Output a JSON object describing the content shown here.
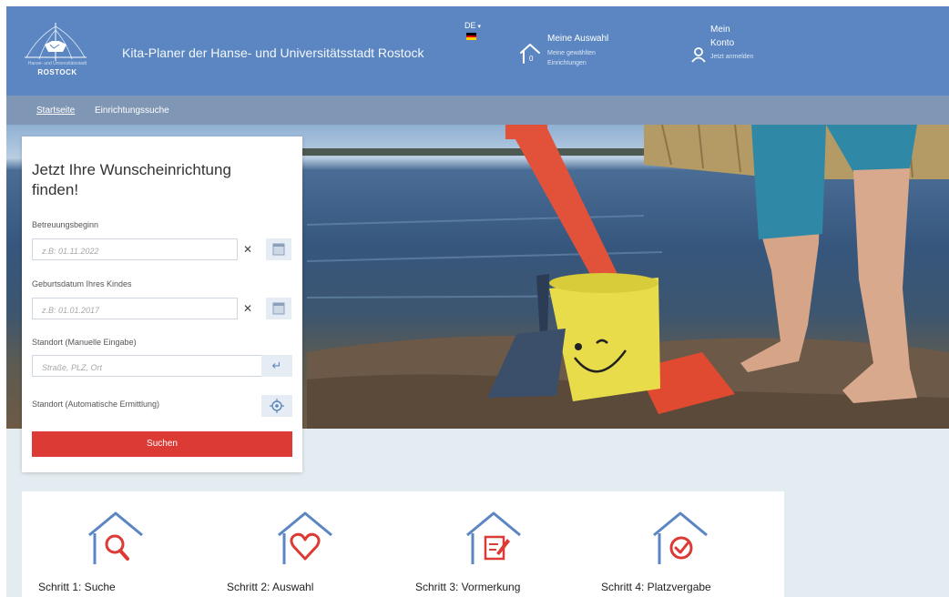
{
  "header": {
    "logo_small_text": "Hanse- und Universitätsstadt",
    "logo_city": "ROSTOCK",
    "site_title": "Kita-Planer der Hanse- und Universitätsstadt Rostock",
    "language": "DE",
    "selection": {
      "title": "Meine Auswahl",
      "subtitle": "Meine gewählten Einrichtungen",
      "count": "0"
    },
    "account": {
      "title": "Mein Konto",
      "subtitle": "Jetzt anmelden"
    }
  },
  "nav": {
    "items": [
      {
        "label": "Startseite",
        "active": true
      },
      {
        "label": "Einrichtungssuche",
        "active": false
      }
    ]
  },
  "search": {
    "heading": "Jetzt Ihre Wunscheinrichtung finden!",
    "start": {
      "label": "Betreuungsbeginn",
      "placeholder": "z.B: 01.11.2022"
    },
    "birth": {
      "label": "Geburtsdatum Ihres Kindes",
      "placeholder": "z.B: 01.01.2017"
    },
    "manual": {
      "label": "Standort (Manuelle Eingabe)",
      "placeholder": "Straße, PLZ, Ort"
    },
    "auto": {
      "label": "Standort (Automatische Ermittlung)"
    },
    "clear_symbol": "✕",
    "enter_symbol": "↵",
    "submit_label": "Suchen"
  },
  "steps": [
    {
      "label": "Schritt 1: Suche",
      "icon": "search-icon"
    },
    {
      "label": "Schritt 2: Auswahl",
      "icon": "heart-icon"
    },
    {
      "label": "Schritt 3: Vormerkung",
      "icon": "document-edit-icon"
    },
    {
      "label": "Schritt 4: Platzvergabe",
      "icon": "check-circle-icon"
    }
  ],
  "colors": {
    "header_bg": "#5b86c1",
    "nav_bg": "#8096b5",
    "page_bg": "#e3ecf1",
    "accent_red": "#dc3a34",
    "step_roof_blue": "#5b86c1"
  }
}
